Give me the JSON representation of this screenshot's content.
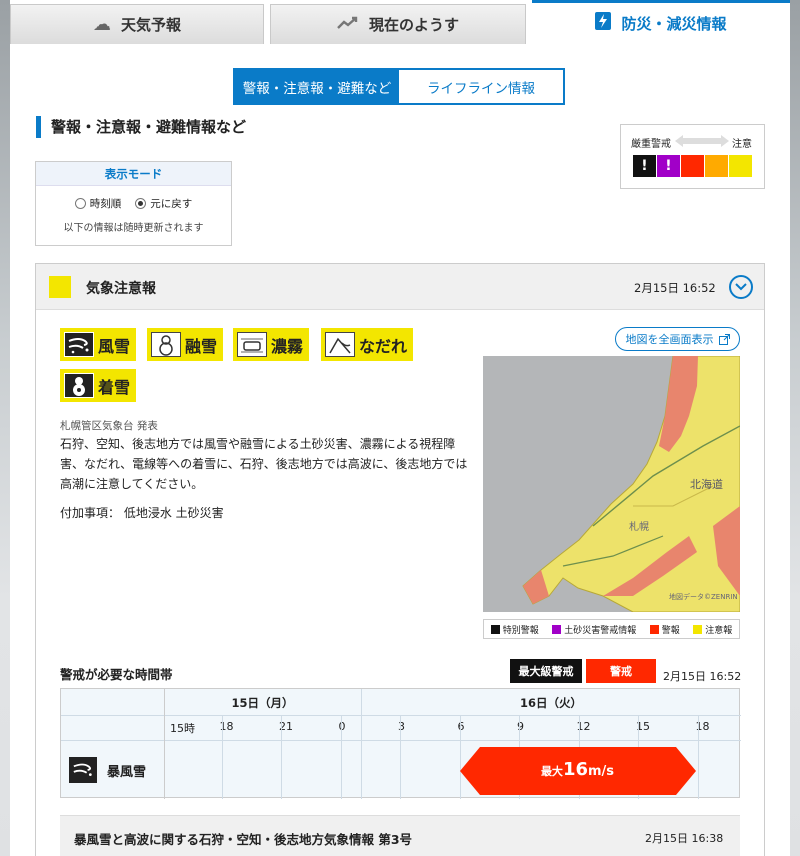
{
  "tabs": [
    {
      "label": "天気予報",
      "icon": "cloud-sun-icon"
    },
    {
      "label": "現在のようす",
      "icon": "trend-line-icon"
    },
    {
      "label": "防災・減災情報",
      "icon": "lightning-icon"
    }
  ],
  "segment": {
    "left": "警報・注意報・避難など",
    "right": "ライフライン情報"
  },
  "section_title": "警報・注意報・避難情報など",
  "severity_legend": {
    "strongest": "厳重警戒",
    "weakest": "注意",
    "levels": [
      "#111111",
      "#a100c8",
      "#ff2800",
      "#ffaa00",
      "#f3e600"
    ]
  },
  "display_mode": {
    "title": "表示モード",
    "options": [
      "時刻順",
      "元に戻す"
    ],
    "selected": "元に戻す",
    "note": "以下の情報は随時更新されます"
  },
  "alert": {
    "title": "気象注意報",
    "datetime": "2月15日 16:52",
    "color": "#f3e600",
    "types": [
      {
        "label": "風雪",
        "icon": "wind-snow-icon"
      },
      {
        "label": "融雪",
        "icon": "snowman-melt-icon"
      },
      {
        "label": "濃霧",
        "icon": "fog-car-icon"
      },
      {
        "label": "なだれ",
        "icon": "avalanche-icon"
      },
      {
        "label": "着雪",
        "icon": "snow-accretion-icon"
      }
    ],
    "issuer": "札幌管区気象台 発表",
    "text": "石狩、空知、後志地方では風雪や融雪による土砂災害、濃霧による視程障害、なだれ、電線等への着雪に、石狩、後志地方では高波に、後志地方では高潮に注意してください。",
    "additional": "付加事項：  低地浸水    土砂災害"
  },
  "map": {
    "button": "地図を全画面表示",
    "labels": {
      "region": "北海道",
      "city": "札幌",
      "credit": "地図データ©ZENRIN"
    },
    "legend": [
      {
        "label": "特別警報",
        "color": "#111111"
      },
      {
        "label": "土砂災害警戒情報",
        "color": "#a100c8"
      },
      {
        "label": "警報",
        "color": "#ff2800"
      },
      {
        "label": "注意報",
        "color": "#f3e600"
      }
    ]
  },
  "timeline": {
    "title": "警戒が必要な時間帯",
    "badge_max": "最大級警戒",
    "badge_warn": "警戒",
    "datetime": "2月15日 16:52",
    "days": [
      "15日（月）",
      "16日（火）"
    ],
    "hours": [
      "15時",
      "18",
      "21",
      "0",
      "3",
      "6",
      "9",
      "12",
      "15",
      "18"
    ],
    "row_label": "暴風雪",
    "row_icon": "wind-snow-icon",
    "bar_prefix": "最大",
    "bar_value": "16",
    "bar_unit": "m/s",
    "bar_start_hour_index": 5,
    "bar_end_hour_index": 9
  },
  "info": {
    "title": "暴風雪と高波に関する石狩・空知・後志地方気象情報 第3号",
    "datetime": "2月15日 16:38"
  }
}
